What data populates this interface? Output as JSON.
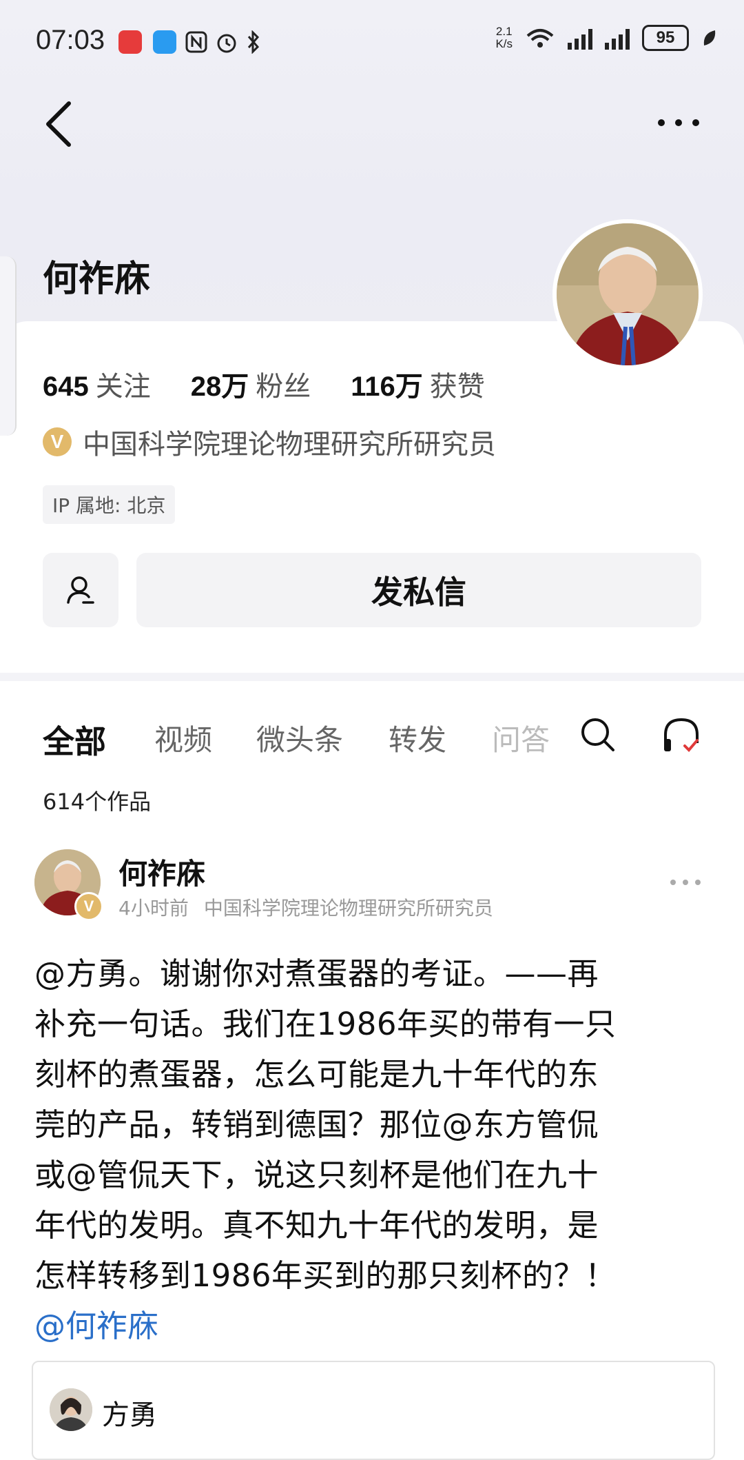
{
  "status_bar": {
    "time": "07:03",
    "speed_top": "2.1",
    "speed_bottom": "K/s",
    "battery": "95"
  },
  "nav": {
    "back_icon": "chevron-left-icon",
    "more_icon": "more-horizontal-icon"
  },
  "profile": {
    "name": "何祚庥",
    "stats": [
      {
        "num": "645",
        "label": "关注"
      },
      {
        "num": "28万",
        "label": "粉丝"
      },
      {
        "num": "116万",
        "label": "获赞"
      }
    ],
    "verify_badge": "V",
    "verify_text": "中国科学院理论物理研究所研究员",
    "ip": "IP 属地: 北京",
    "message_button": "发私信",
    "follow_icon": "user-follow-icon"
  },
  "tabs": {
    "items": [
      "全部",
      "视频",
      "微头条",
      "转发",
      "问答"
    ],
    "active": "全部"
  },
  "works_count": "614个作品",
  "post": {
    "author": "何祚庥",
    "badge": "V",
    "time": "4小时前",
    "author_title": "中国科学院理论物理研究所研究员",
    "lines": [
      "@方勇。谢谢你对煮蛋器的考证。——再",
      "补充一句话。我们在1986年买的带有一只",
      "刻杯的煮蛋器，怎么可能是九十年代的东",
      "莞的产品，转销到德国？那位@东方管侃",
      "或@管侃天下，说这只刻杯是他们在九十",
      "年代的发明。真不知九十年代的发明，是",
      "怎样转移到1986年买到的那只刻杯的？！"
    ],
    "mention": "@何祚庥",
    "quote_author": "方勇"
  },
  "colors": {
    "link": "#2a6fc9",
    "badge": "#e2b96a",
    "bg_hero": "#ececf4"
  }
}
